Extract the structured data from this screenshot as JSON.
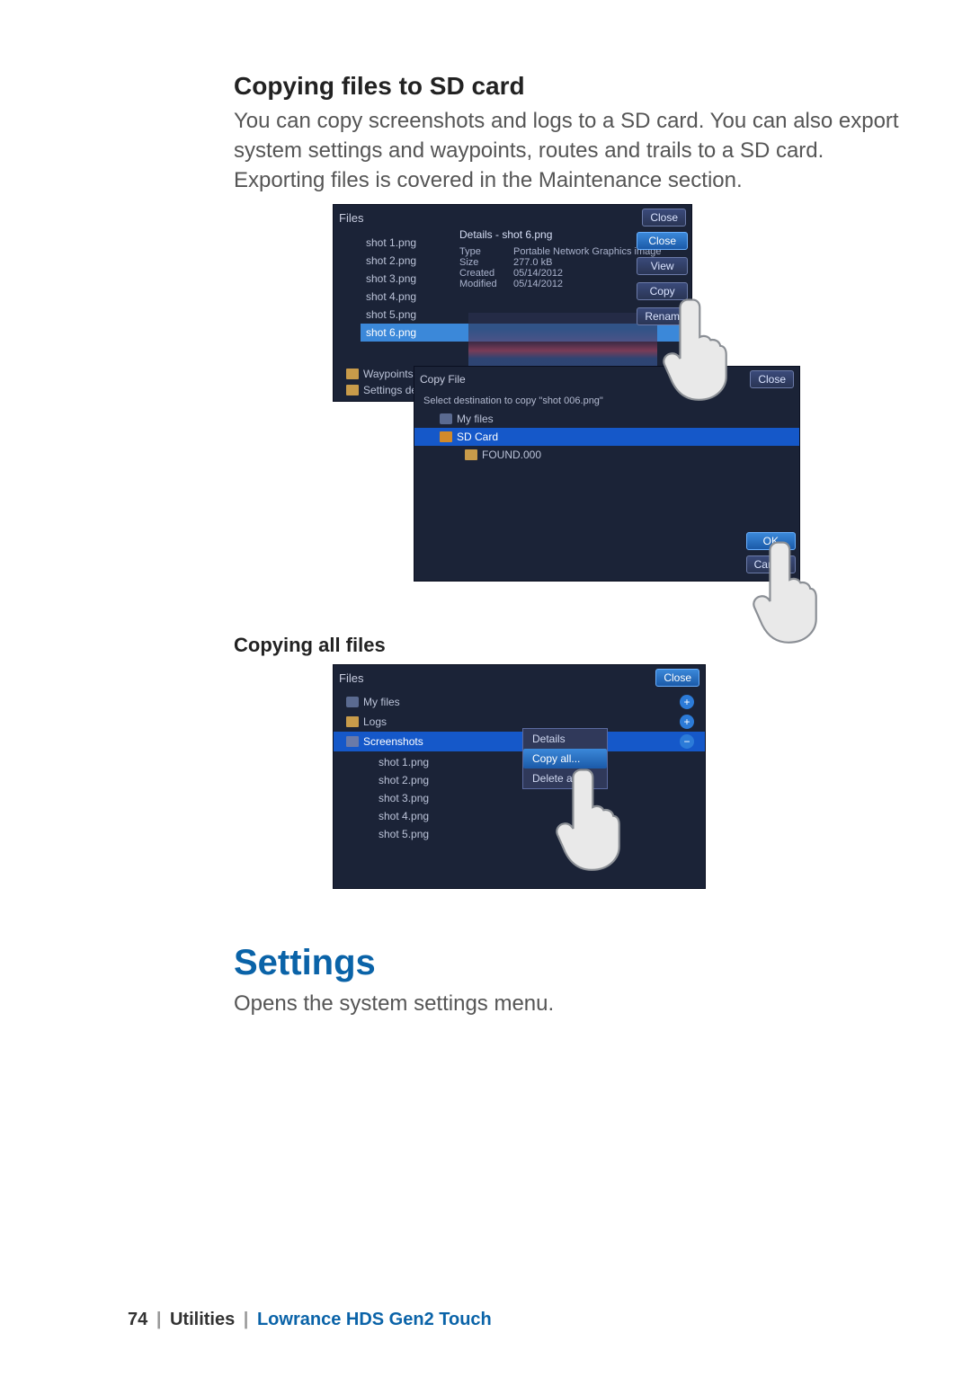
{
  "heading": "Copying files to SD card",
  "intro": "You can copy screenshots and logs to a SD card. You can also export system settings and waypoints, routes and trails to a SD card. Exporting files is covered in the Maintenance section.",
  "subheading": "Copying all files",
  "section": "Settings",
  "sectionBody": "Opens the system settings menu.",
  "footer": {
    "page": "74",
    "chapter": "Utilities",
    "product": "Lowrance HDS Gen2 Touch"
  },
  "shot1": {
    "filesTitle": "Files",
    "close": "Close",
    "files": [
      "shot 1.png",
      "shot 2.png",
      "shot 3.png",
      "shot 4.png",
      "shot 5.png",
      "shot 6.png"
    ],
    "treeExtra": [
      "Waypoints,",
      "Settings de"
    ],
    "detailsTitle": "Details - shot 6.png",
    "detRows": [
      [
        "Type",
        "Portable Network Graphics image"
      ],
      [
        "Size",
        "277.0 kB"
      ],
      [
        "Created",
        "05/14/2012"
      ],
      [
        "Modified",
        "05/14/2012"
      ]
    ],
    "detBtns": [
      "Close",
      "View",
      "Copy",
      "Renam"
    ],
    "copyTitle": "Copy File",
    "copyClose": "Close",
    "destPrompt": "Select destination to copy \"shot 006.png\"",
    "dest": [
      {
        "label": "My files",
        "icon": "hdd"
      },
      {
        "label": "SD Card",
        "icon": "sd",
        "sel": true
      },
      {
        "label": "FOUND.000",
        "icon": "fold",
        "sub": true
      }
    ],
    "ok": "OK",
    "cancel": "Cancel"
  },
  "shot2": {
    "filesTitle": "Files",
    "close": "Close",
    "tree": [
      {
        "label": "My files",
        "icon": "hdd",
        "exp": "+"
      },
      {
        "label": "Logs",
        "icon": "fold",
        "exp": "+"
      },
      {
        "label": "Screenshots",
        "icon": "sh",
        "exp": "−",
        "sel": true
      }
    ],
    "files": [
      "shot 1.png",
      "shot 2.png",
      "shot 3.png",
      "shot 4.png",
      "shot 5.png"
    ],
    "menu": [
      "Details",
      "Copy all...",
      "Delete all"
    ]
  }
}
